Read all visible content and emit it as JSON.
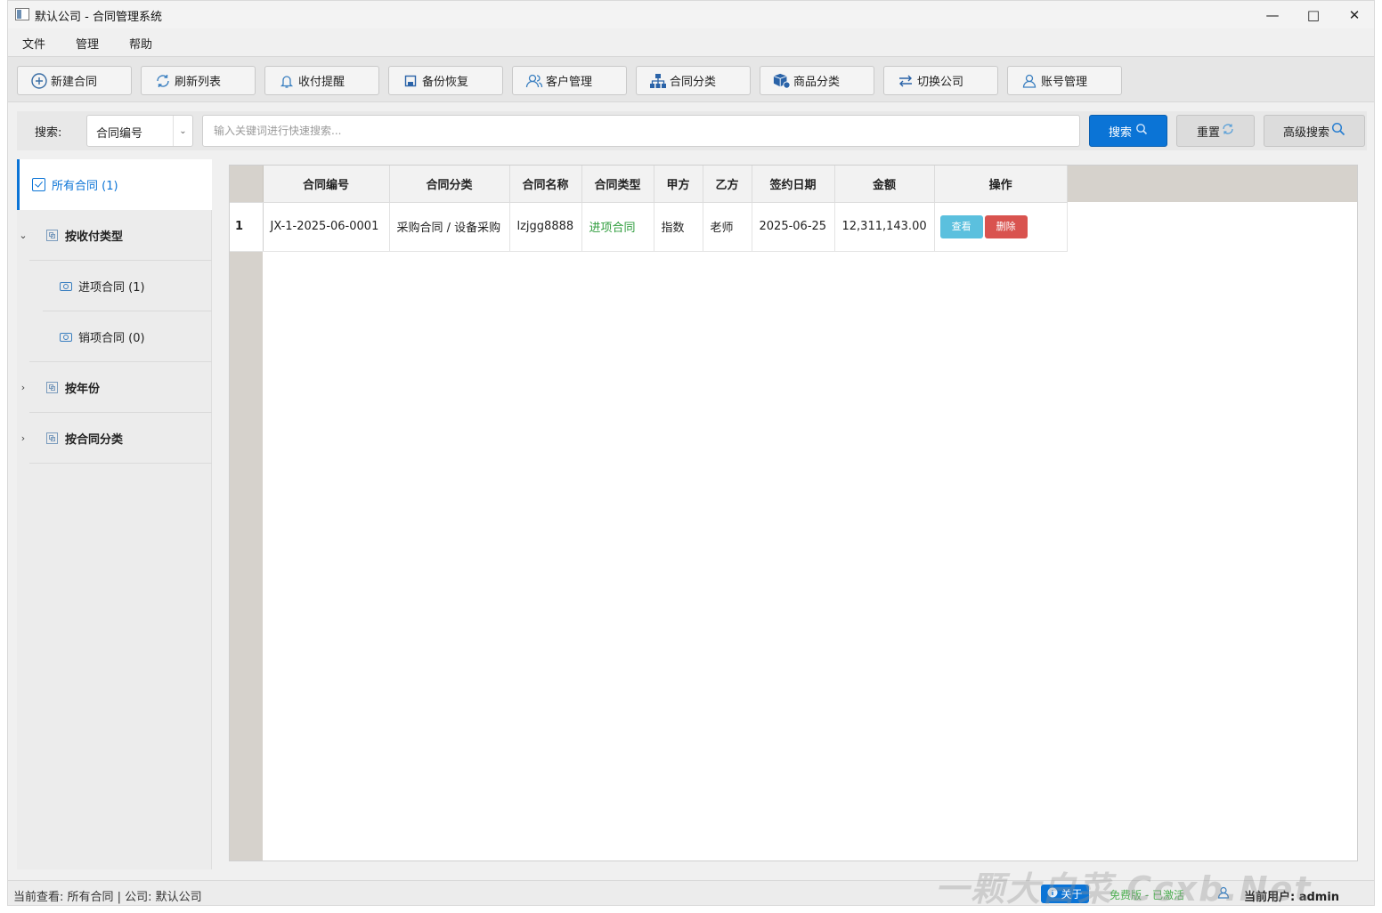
{
  "window": {
    "title": "默认公司 - 合同管理系统"
  },
  "menu": [
    "文件",
    "管理",
    "帮助"
  ],
  "toolbar": [
    {
      "label": "新建合同",
      "icon": "plus-circle-icon"
    },
    {
      "label": "刷新列表",
      "icon": "refresh-icon"
    },
    {
      "label": "收付提醒",
      "icon": "bell-icon"
    },
    {
      "label": "备份恢复",
      "icon": "floppy-icon"
    },
    {
      "label": "客户管理",
      "icon": "users-icon"
    },
    {
      "label": "合同分类",
      "icon": "sitemap-icon"
    },
    {
      "label": "商品分类",
      "icon": "box-icon"
    },
    {
      "label": "切换公司",
      "icon": "swap-icon"
    },
    {
      "label": "账号管理",
      "icon": "user-icon"
    }
  ],
  "search": {
    "label": "搜索:",
    "field_selected": "合同编号",
    "placeholder": "输入关键词进行快速搜索...",
    "search_label": "搜索",
    "reset_label": "重置",
    "advanced_label": "高级搜索"
  },
  "sidebar": {
    "all": "所有合同 (1)",
    "by_payment": "按收付类型",
    "incoming": "进项合同 (1)",
    "outgoing": "销项合同 (0)",
    "by_year": "按年份",
    "by_category": "按合同分类"
  },
  "table": {
    "columns": [
      "合同编号",
      "合同分类",
      "合同名称",
      "合同类型",
      "甲方",
      "乙方",
      "签约日期",
      "金额",
      "操作"
    ],
    "rows": [
      {
        "index": "1",
        "number": "JX-1-2025-06-0001",
        "category": "采购合同 / 设备采购",
        "name": "lzjgg8888",
        "type": "进项合同",
        "party_a": "指数",
        "party_b": "老师",
        "date": "2025-06-25",
        "amount": "12,311,143.00",
        "view_label": "查看",
        "delete_label": "删除"
      }
    ]
  },
  "status": {
    "left": "当前查看: 所有合同 | 公司: 默认公司",
    "about": "关于",
    "license": "免费版 - 已激活",
    "user": "当前用户: admin"
  },
  "watermark": "一颗大白菜 Ccxb.Net",
  "colors": {
    "accent": "#0b74d6",
    "view": "#5bc0de",
    "delete": "#d9534f",
    "incoming_type": "#2e9c3c"
  }
}
